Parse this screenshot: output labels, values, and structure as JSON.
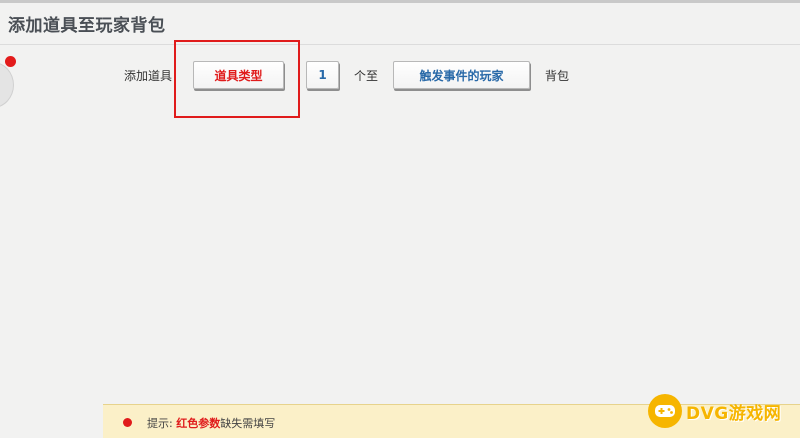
{
  "title": "添加道具至玩家背包",
  "row": {
    "prefix": "添加道具",
    "param_item_type": "道具类型",
    "param_count": "1",
    "middle": "个至",
    "param_player": "触发事件的玩家",
    "suffix": "背包"
  },
  "hint": {
    "label": "提示: ",
    "red": "红色参数",
    "rest": "缺失需填写"
  },
  "watermark": {
    "text": "DVG游戏网"
  },
  "colors": {
    "param_missing": "#e01b1b",
    "param_set": "#2869a8",
    "hint_bg": "#fbf0c8",
    "logo": "#f6b500"
  }
}
